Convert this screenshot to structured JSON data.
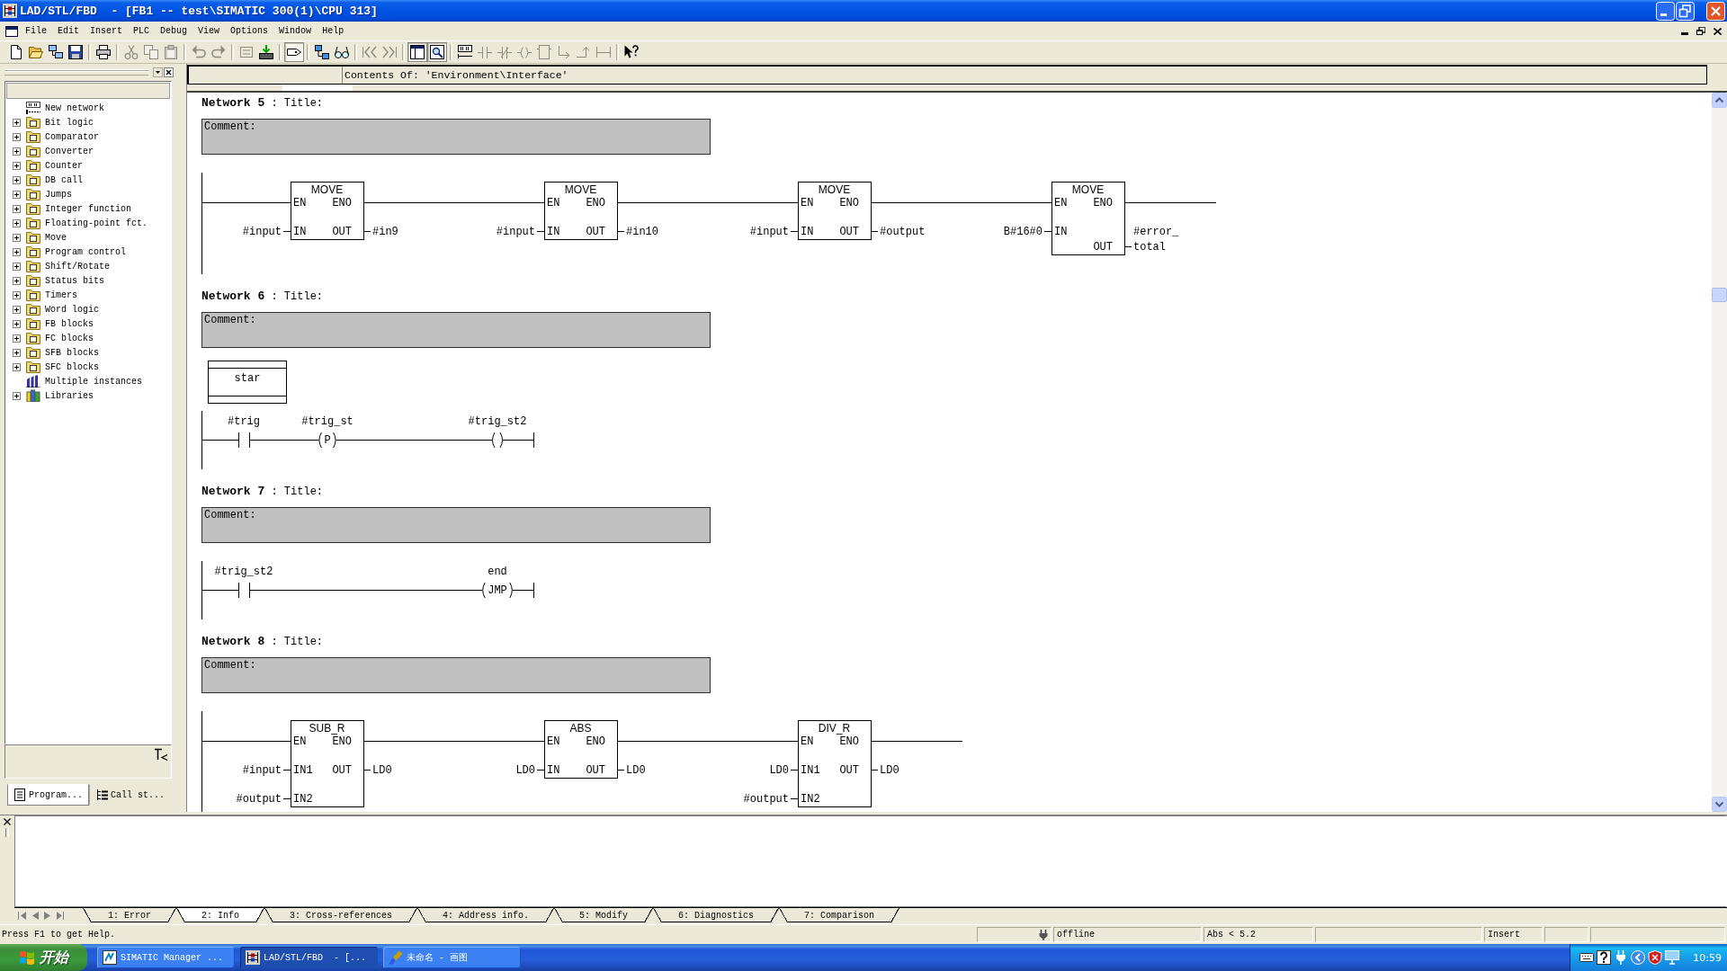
{
  "window": {
    "title": "LAD/STL/FBD  - [FB1 -- test\\SIMATIC 300(1)\\CPU 313]"
  },
  "menu": [
    "File",
    "Edit",
    "Insert",
    "PLC",
    "Debug",
    "View",
    "Options",
    "Window",
    "Help"
  ],
  "toolbar": [
    [
      {
        "disabled": false,
        "pressed": false
      },
      {
        "disabled": false,
        "pressed": false
      },
      {
        "disabled": false,
        "pressed": false
      },
      {
        "disabled": false,
        "pressed": false
      }
    ],
    [
      {
        "disabled": false,
        "pressed": false
      }
    ],
    [
      {
        "disabled": true,
        "pressed": false
      },
      {
        "disabled": true,
        "pressed": false
      },
      {
        "disabled": true,
        "pressed": false
      }
    ],
    [
      {
        "disabled": true,
        "pressed": false
      },
      {
        "disabled": true,
        "pressed": false
      }
    ],
    [
      {
        "disabled": true,
        "pressed": false
      },
      {
        "disabled": false,
        "pressed": false
      }
    ],
    [
      {
        "disabled": false,
        "pressed": true
      }
    ],
    [
      {
        "disabled": false,
        "pressed": false
      },
      {
        "disabled": false,
        "pressed": false
      }
    ],
    [
      {
        "disabled": true,
        "pressed": false
      },
      {
        "disabled": true,
        "pressed": false
      }
    ],
    [
      {
        "disabled": false,
        "pressed": true
      },
      {
        "disabled": false,
        "pressed": true
      }
    ],
    [
      {
        "disabled": false,
        "pressed": false
      },
      {
        "disabled": true,
        "pressed": false
      },
      {
        "disabled": true,
        "pressed": false
      },
      {
        "disabled": true,
        "pressed": false
      },
      {
        "disabled": true,
        "pressed": false
      },
      {
        "disabled": true,
        "pressed": false
      },
      {
        "disabled": true,
        "pressed": false
      },
      {
        "disabled": true,
        "pressed": false
      }
    ],
    [
      {
        "disabled": false,
        "pressed": false
      }
    ]
  ],
  "program_elements": {
    "items": [
      {
        "label": "New network",
        "kind": "network"
      },
      {
        "label": "Bit logic",
        "kind": "folder",
        "expanded": false
      },
      {
        "label": "Comparator",
        "kind": "folder",
        "expanded": false
      },
      {
        "label": "Converter",
        "kind": "folder",
        "expanded": false
      },
      {
        "label": "Counter",
        "kind": "folder",
        "expanded": false
      },
      {
        "label": "DB call",
        "kind": "folder",
        "expanded": false
      },
      {
        "label": "Jumps",
        "kind": "folder",
        "expanded": false
      },
      {
        "label": "Integer function",
        "kind": "folder",
        "expanded": false
      },
      {
        "label": "Floating-point fct.",
        "kind": "folder",
        "expanded": false
      },
      {
        "label": "Move",
        "kind": "folder",
        "expanded": false
      },
      {
        "label": "Program control",
        "kind": "folder",
        "expanded": false
      },
      {
        "label": "Shift/Rotate",
        "kind": "folder",
        "expanded": false
      },
      {
        "label": "Status bits",
        "kind": "folder",
        "expanded": false
      },
      {
        "label": "Timers",
        "kind": "folder",
        "expanded": false
      },
      {
        "label": "Word logic",
        "kind": "folder",
        "expanded": false
      },
      {
        "label": "FB blocks",
        "kind": "folder",
        "expanded": false
      },
      {
        "label": "FC blocks",
        "kind": "folder",
        "expanded": false
      },
      {
        "label": "SFB blocks",
        "kind": "folder",
        "expanded": false
      },
      {
        "label": "SFC blocks",
        "kind": "folder",
        "expanded": false
      },
      {
        "label": "Multiple instances",
        "kind": "instances"
      },
      {
        "label": "Libraries",
        "kind": "library",
        "expanded": false
      }
    ],
    "tabs": [
      {
        "label": "Program...",
        "selected": true
      },
      {
        "label": "Call st...",
        "selected": false
      }
    ]
  },
  "declaration": {
    "header": "Contents Of: 'Environment\\Interface'"
  },
  "networks": [
    {
      "heading": "**Network 5** : Title:",
      "comment": "Comment:",
      "rung": {
        "kind": "boxes",
        "elements": [
          {
            "name": "MOVE",
            "inputs": [
              {
                "pin": "EN"
              },
              {
                "pin": "IN",
                "operand": "#input"
              }
            ],
            "outputs": [
              {
                "pin": "ENO"
              },
              {
                "pin": "OUT",
                "operand": "#in9"
              }
            ]
          },
          {
            "name": "MOVE",
            "inputs": [
              {
                "pin": "EN"
              },
              {
                "pin": "IN",
                "operand": "#input"
              }
            ],
            "outputs": [
              {
                "pin": "ENO"
              },
              {
                "pin": "OUT",
                "operand": "#in10"
              }
            ]
          },
          {
            "name": "MOVE",
            "inputs": [
              {
                "pin": "EN"
              },
              {
                "pin": "IN",
                "operand": "#input"
              }
            ],
            "outputs": [
              {
                "pin": "ENO"
              },
              {
                "pin": "OUT",
                "operand": "#output"
              }
            ]
          },
          {
            "name": "MOVE",
            "inputs": [
              {
                "pin": "EN"
              },
              {
                "pin": "IN",
                "operand": "B#16#0"
              }
            ],
            "outputs": [
              {
                "pin": "ENO"
              },
              {
                "pin": "OUT",
                "operand": "#error_total"
              }
            ]
          }
        ]
      }
    },
    {
      "heading": "**Network 6** : Title:",
      "comment": "Comment:",
      "label": "star",
      "rung": {
        "kind": "contacts",
        "elements": [
          {
            "kind": "contact",
            "operand": "#trig"
          },
          {
            "kind": "midline",
            "symbol": "P",
            "operand": "#trig_st"
          },
          {
            "kind": "coil",
            "operand": "#trig_st2"
          }
        ]
      }
    },
    {
      "heading": "**Network 7** : Title:",
      "comment": "Comment:",
      "rung": {
        "kind": "contacts",
        "elements": [
          {
            "kind": "contact",
            "operand": "#trig_st2"
          },
          {
            "kind": "coil",
            "symbol": "JMP",
            "operand": "end"
          }
        ]
      }
    },
    {
      "heading": "**Network 8** : Title:",
      "comment": "Comment:",
      "rung": {
        "kind": "boxes",
        "elements": [
          {
            "name": "SUB_R",
            "inputs": [
              {
                "pin": "EN"
              },
              {
                "pin": "IN1",
                "operand": "#input"
              },
              {
                "pin": "IN2",
                "operand": "#output"
              }
            ],
            "outputs": [
              {
                "pin": "ENO"
              },
              {
                "pin": "OUT",
                "operand": "LD0"
              }
            ]
          },
          {
            "name": "ABS",
            "inputs": [
              {
                "pin": "EN"
              },
              {
                "pin": "IN",
                "operand": "LD0"
              }
            ],
            "outputs": [
              {
                "pin": "ENO"
              },
              {
                "pin": "OUT",
                "operand": "LD0"
              }
            ]
          },
          {
            "name": "DIV_R",
            "inputs": [
              {
                "pin": "EN"
              },
              {
                "pin": "IN1",
                "operand": "LD0"
              },
              {
                "pin": "IN2",
                "operand": "#output"
              }
            ],
            "outputs": [
              {
                "pin": "ENO"
              },
              {
                "pin": "OUT",
                "operand": "LD0"
              }
            ]
          }
        ]
      }
    }
  ],
  "output": {
    "tabs": [
      {
        "label": "1: Error",
        "selected": false
      },
      {
        "label": "2: Info",
        "selected": true
      },
      {
        "label": "3: Cross-references",
        "selected": false
      },
      {
        "label": "4: Address info.",
        "selected": false
      },
      {
        "label": "5: Modify",
        "selected": false
      },
      {
        "label": "6: Diagnostics",
        "selected": false
      },
      {
        "label": "7: Comparison",
        "selected": false
      }
    ]
  },
  "status_bar": {
    "message": "Press F1 to get Help.",
    "connection": "offline",
    "address": "Abs < 5.2",
    "mode": "Insert"
  },
  "taskbar": {
    "start": "开始",
    "tasks": [
      {
        "label": "SIMATIC Manager ...",
        "selected": false
      },
      {
        "label": "LAD/STL/FBD  - [...",
        "selected": true
      },
      {
        "label": "未命名 - 画图",
        "selected": false
      }
    ],
    "clock": "10:59"
  }
}
